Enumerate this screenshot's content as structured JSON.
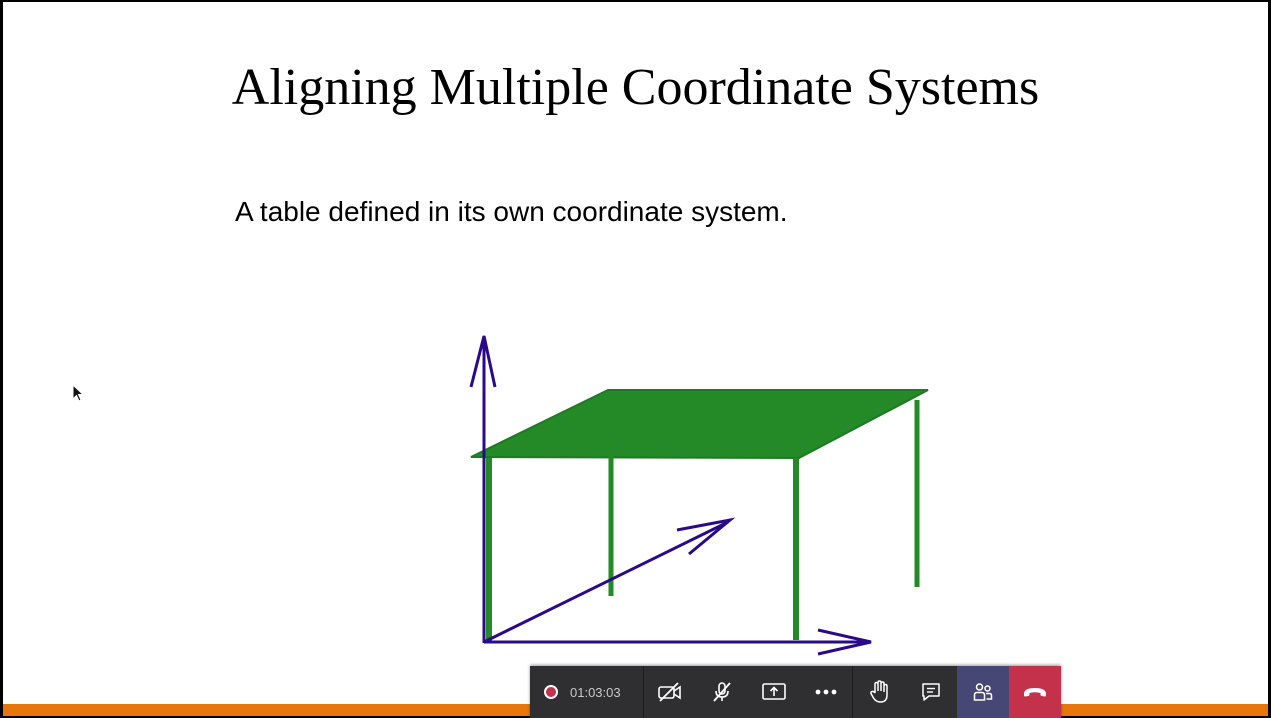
{
  "slide": {
    "title": "Aligning Multiple Coordinate Systems",
    "subtitle": "A table defined in its own coordinate system.",
    "colors": {
      "axes": "#2b0a8a",
      "table": "#238a27",
      "accent_bar": "#e6780b"
    }
  },
  "toolbar": {
    "recording_icon": "record-icon",
    "timer": "01:03:03",
    "buttons": [
      {
        "name": "camera-off-icon"
      },
      {
        "name": "mic-off-icon"
      },
      {
        "name": "share-screen-icon"
      },
      {
        "name": "more-options-icon"
      },
      {
        "name": "raise-hand-icon"
      },
      {
        "name": "chat-icon"
      },
      {
        "name": "participants-icon"
      },
      {
        "name": "hang-up-icon"
      }
    ],
    "colors": {
      "bar": "#2f2f31",
      "participants_active": "#464775",
      "hangup": "#c4314b"
    }
  }
}
